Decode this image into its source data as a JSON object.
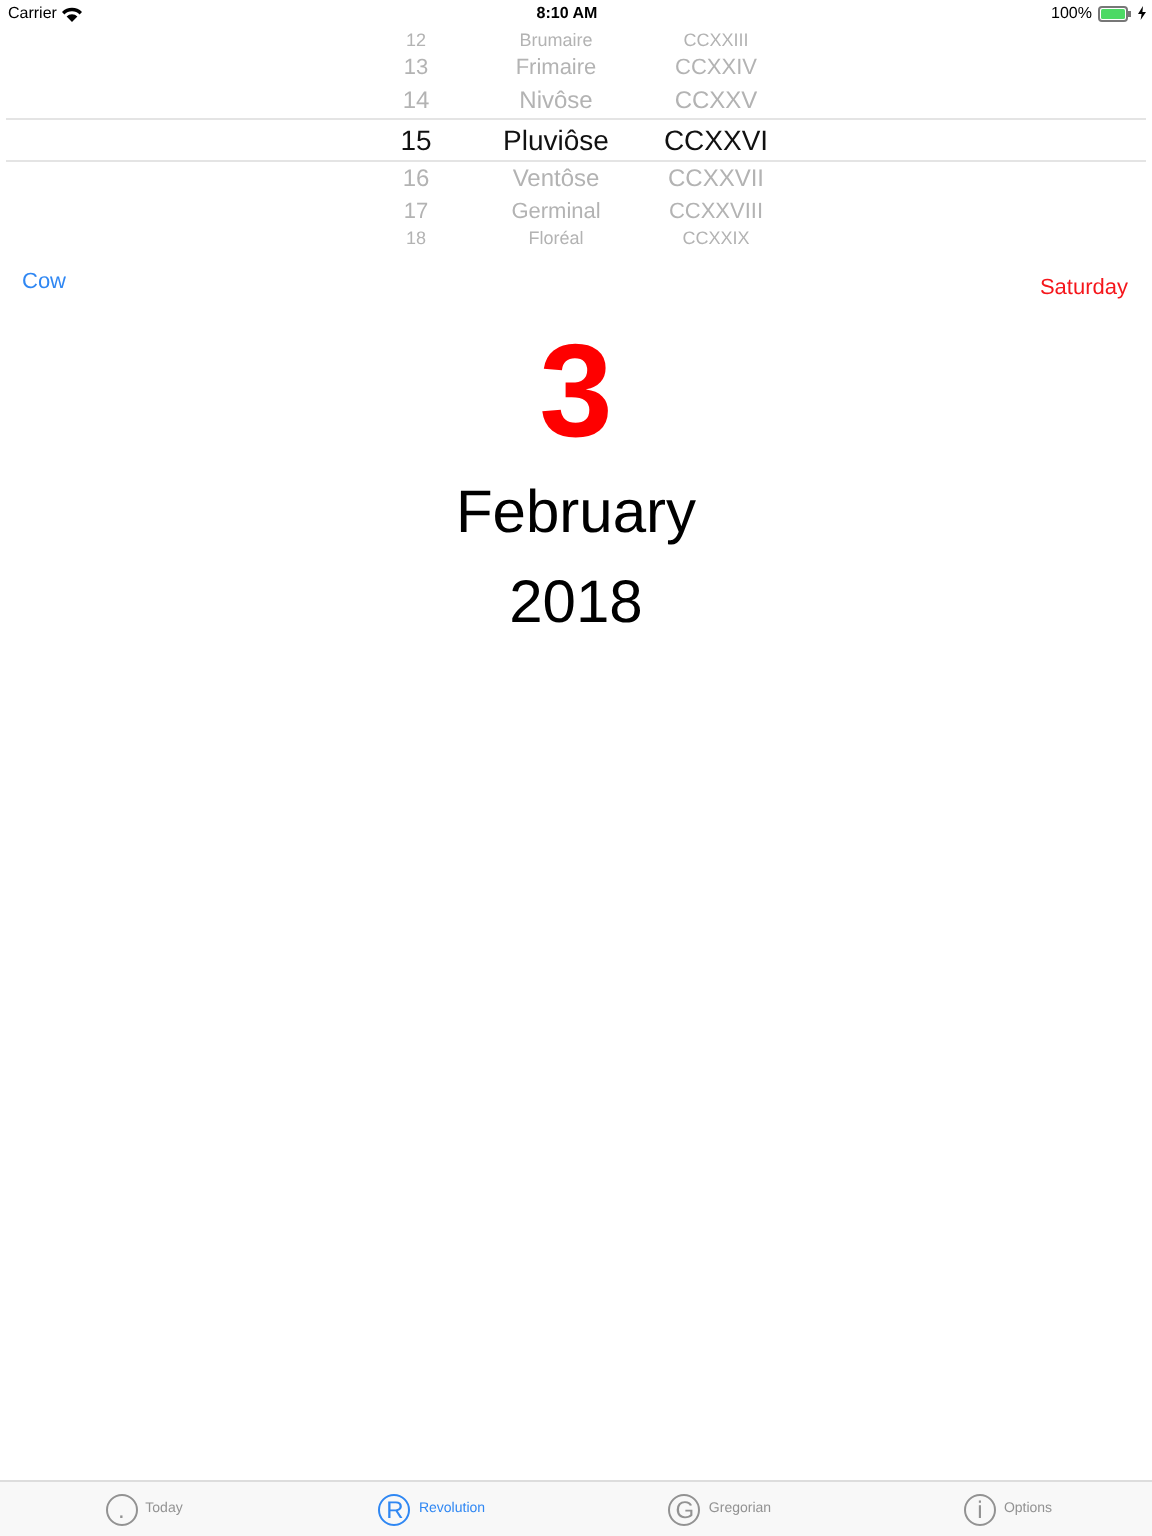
{
  "status_bar": {
    "carrier": "Carrier",
    "time": "8:10 AM",
    "battery": "100%",
    "charging": true
  },
  "picker": {
    "rows": [
      {
        "day": "12",
        "month": "Brumaire",
        "year": "CCXXIII",
        "selected": false
      },
      {
        "day": "13",
        "month": "Frimaire",
        "year": "CCXXIV",
        "selected": false
      },
      {
        "day": "14",
        "month": "Nivôse",
        "year": "CCXXV",
        "selected": false
      },
      {
        "day": "15",
        "month": "Pluviôse",
        "year": "CCXXVI",
        "selected": true
      },
      {
        "day": "16",
        "month": "Ventôse",
        "year": "CCXXVII",
        "selected": false
      },
      {
        "day": "17",
        "month": "Germinal",
        "year": "CCXXVIII",
        "selected": false
      },
      {
        "day": "18",
        "month": "Floréal",
        "year": "CCXXIX",
        "selected": false
      }
    ]
  },
  "day_name": "Cow",
  "weekday": "Saturday",
  "day": "3",
  "month": "February",
  "year": "2018",
  "tabs": [
    {
      "glyph": ".",
      "label": "Today",
      "selected": false
    },
    {
      "glyph": "R",
      "label": "Revolution",
      "selected": true
    },
    {
      "glyph": "G",
      "label": "Gregorian",
      "selected": false
    },
    {
      "glyph": "i",
      "label": "Options",
      "selected": false
    }
  ]
}
